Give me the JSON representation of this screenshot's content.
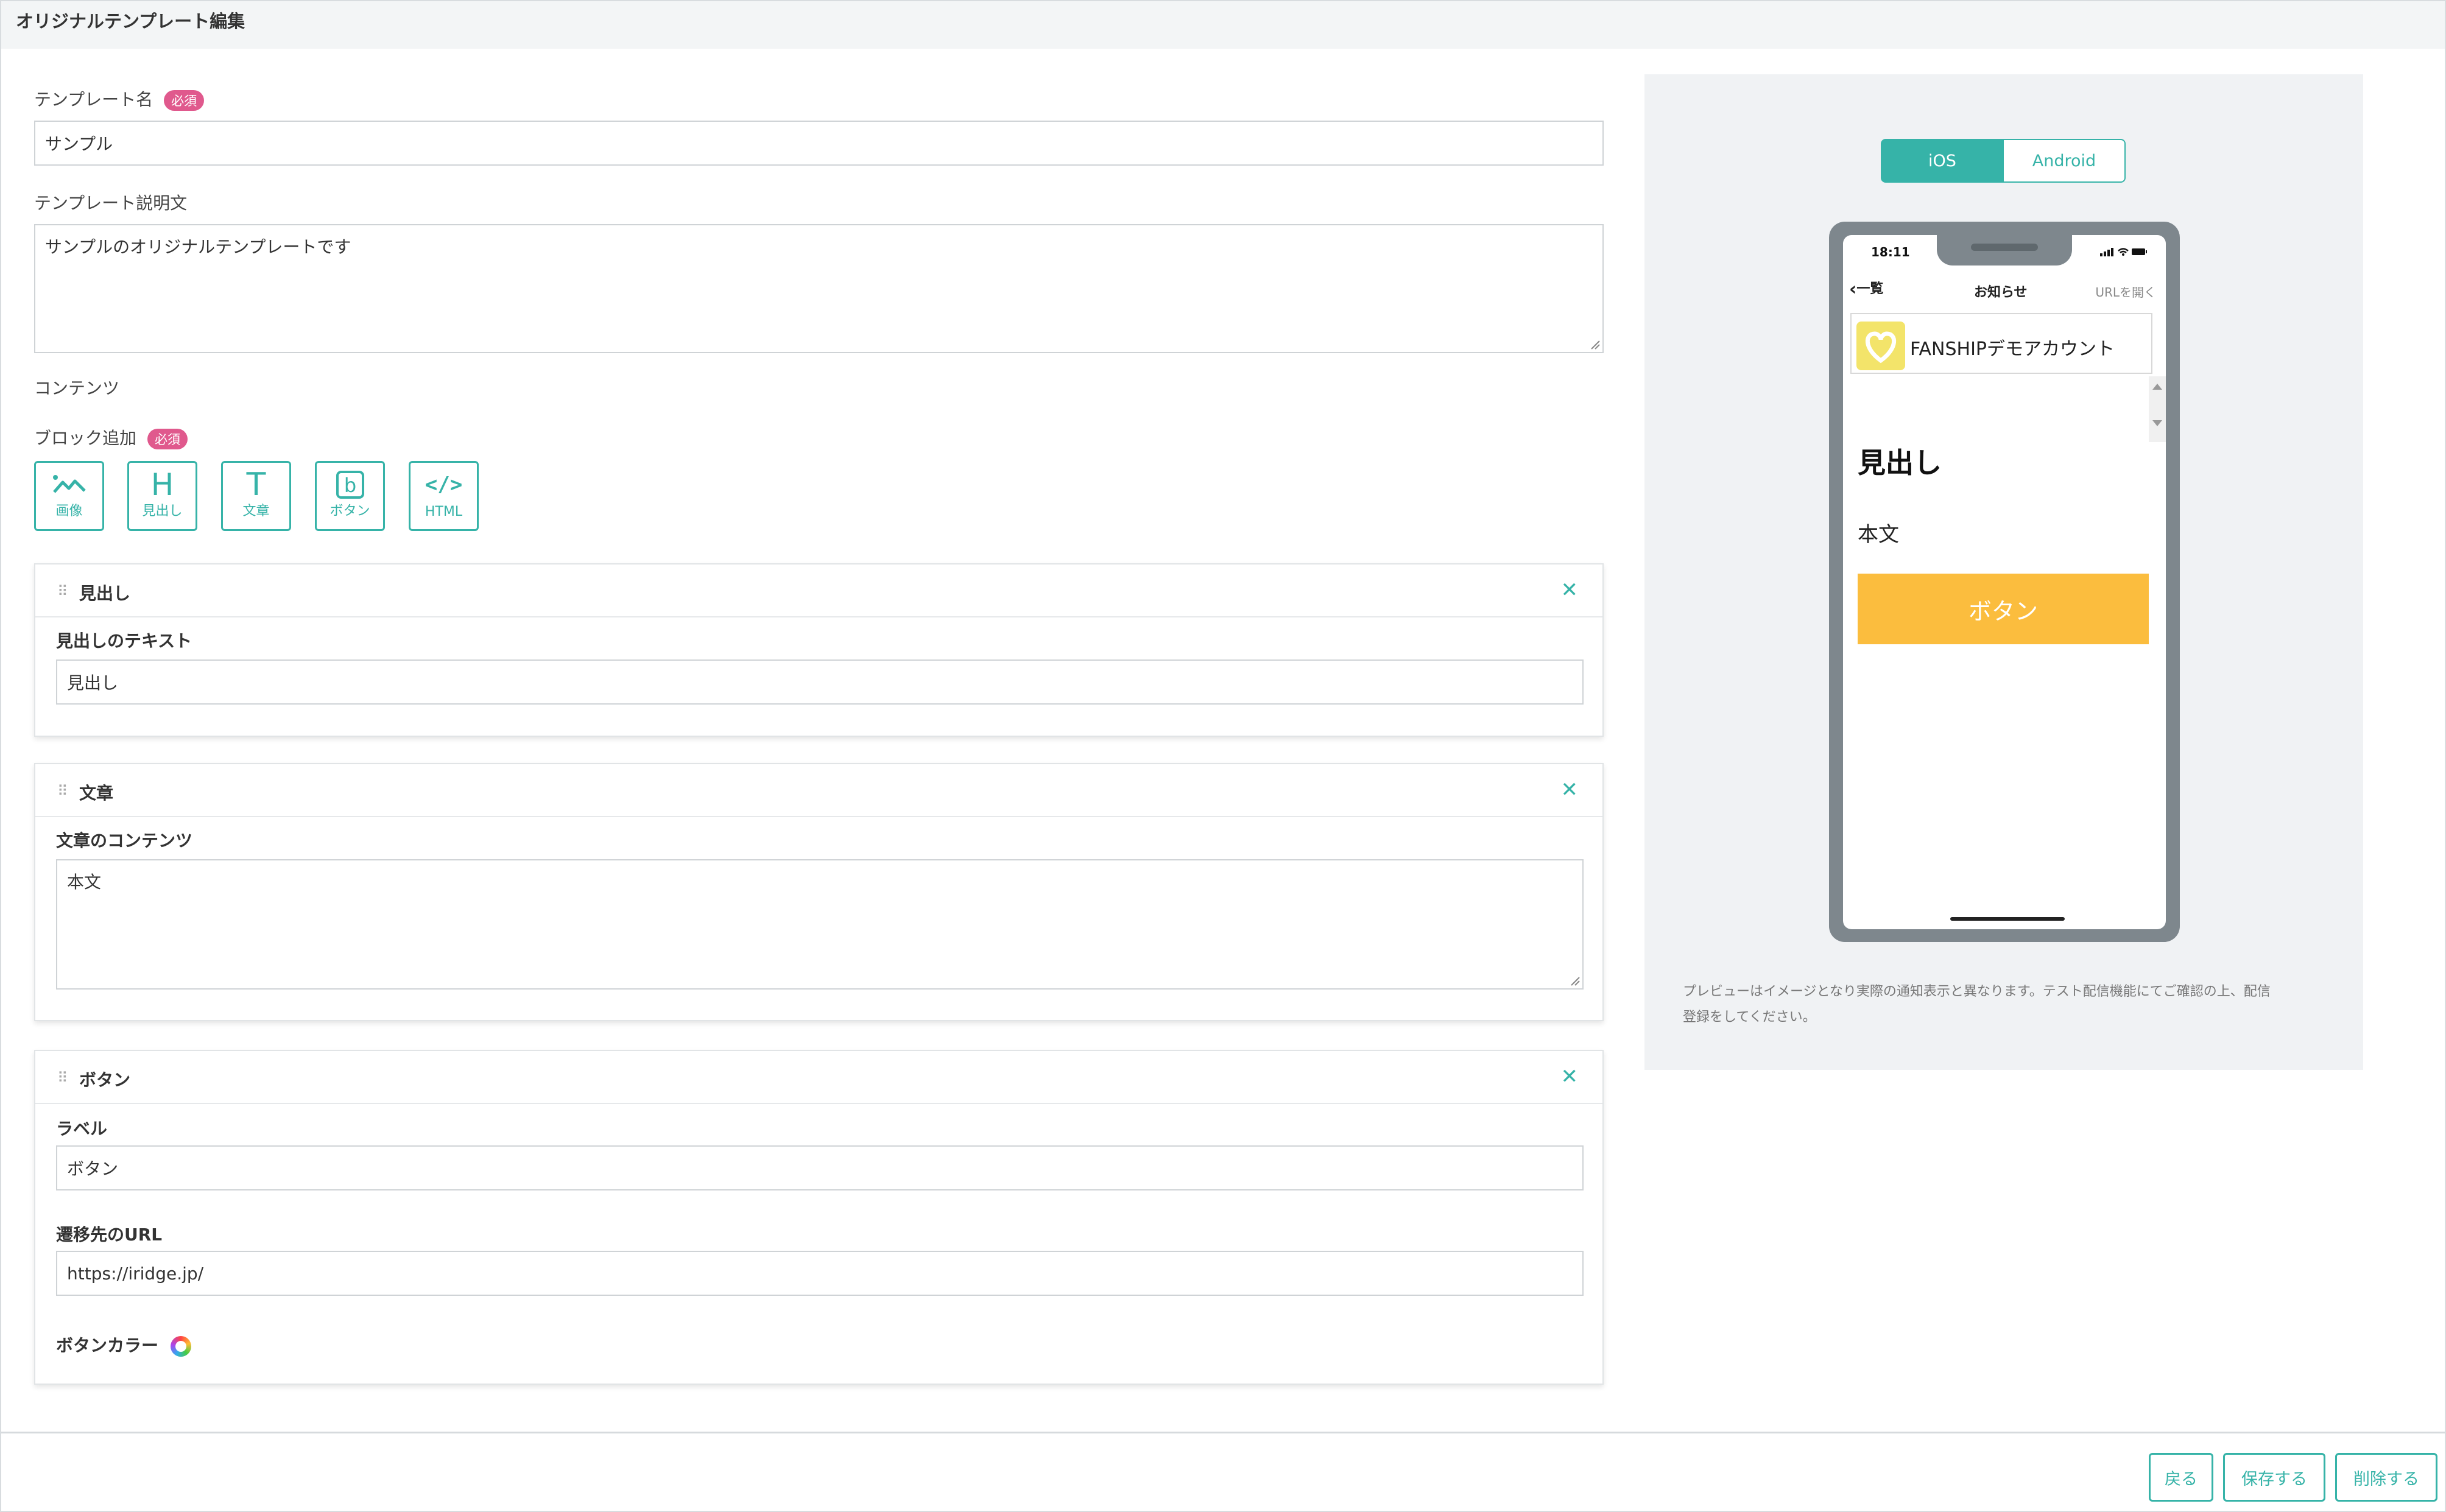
{
  "page": {
    "title": "オリジナルテンプレート編集"
  },
  "form": {
    "name_label": "テンプレート名",
    "required_badge": "必須",
    "name_value": "サンプル",
    "desc_label": "テンプレート説明文",
    "desc_value": "サンプルのオリジナルテンプレートです",
    "contents_label": "コンテンツ",
    "block_add_label": "ブロック追加"
  },
  "block_types": [
    {
      "label": "画像",
      "icon": "image-icon"
    },
    {
      "label": "見出し",
      "icon": "heading-icon"
    },
    {
      "label": "文章",
      "icon": "text-icon"
    },
    {
      "label": "ボタン",
      "icon": "button-icon"
    },
    {
      "label": "HTML",
      "icon": "code-icon"
    }
  ],
  "blocks": {
    "heading": {
      "title": "見出し",
      "field_label": "見出しのテキスト",
      "value": "見出し"
    },
    "text": {
      "title": "文章",
      "field_label": "文章のコンテンツ",
      "value": "本文"
    },
    "button": {
      "title": "ボタン",
      "label_field": "ラベル",
      "label_value": "ボタン",
      "url_field": "遷移先のURL",
      "url_value": "https://iridge.jp/",
      "color_field": "ボタンカラー"
    }
  },
  "preview": {
    "tabs": [
      "iOS",
      "Android"
    ],
    "active_tab": "iOS",
    "phone": {
      "time": "18:11",
      "back_label": "一覧",
      "nav_title": "お知らせ",
      "open_url": "URLを開く",
      "account_name": "FANSHIPデモアカウント",
      "heading": "見出し",
      "body": "本文",
      "button": "ボタン"
    },
    "note_line1": "プレビューはイメージとなり実際の通知表示と異なります。テスト配信機能にてご確認の上、配信",
    "note_line2": "登録をしてください。"
  },
  "footer": {
    "back": "戻る",
    "save": "保存する",
    "delete": "削除する"
  },
  "colors": {
    "accent": "#36b3a8",
    "badge": "#e0598d",
    "preview_button": "#fbbd3e",
    "logo_bg": "#f3e46a"
  }
}
